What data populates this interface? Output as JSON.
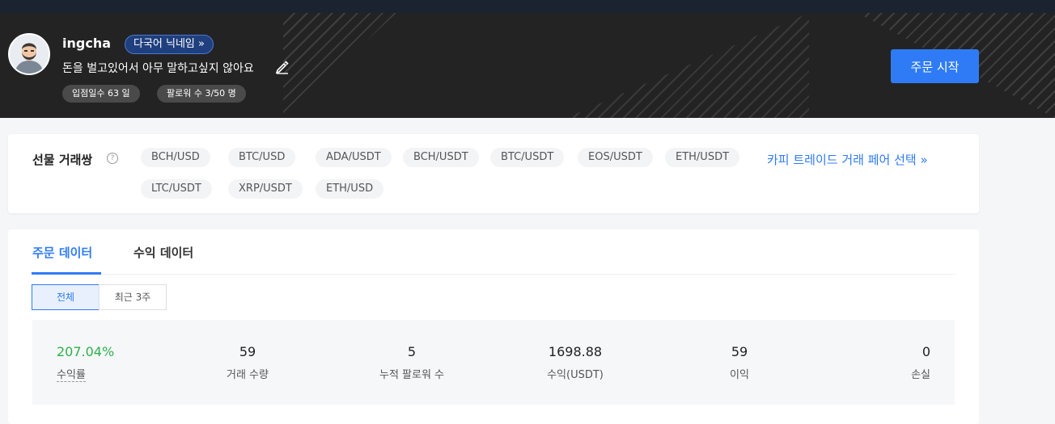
{
  "profile": {
    "username": "ingcha",
    "nickname_badge": "다국어 닉네임",
    "nickname_badge_icon": "double-chevron-right-icon",
    "motto": "돈을 벌고있어서 아무 말하고싶지 않아요",
    "edit_icon": "pencil-icon",
    "days_label": "입점일수 63 일",
    "followers_label": "팔로워 수 3/50 명",
    "start_button": "주문 시작"
  },
  "pairs": {
    "title": "선물 거래쌍",
    "help_icon": "question-circle-icon",
    "items": [
      "BCH/USD",
      "BTC/USD",
      "ADA/USDT",
      "BCH/USDT",
      "BTC/USDT",
      "EOS/USDT",
      "ETH/USDT",
      "LTC/USDT",
      "XRP/USDT",
      "ETH/USD"
    ],
    "copy_link": "카피 트레이드 거래 페어 선택"
  },
  "data": {
    "tabs": [
      "주문 데이터",
      "수익 데이터"
    ],
    "active_tab": "주문 데이터",
    "ranges": [
      "전체",
      "최근 3주"
    ],
    "active_range": "전체",
    "stats": [
      {
        "value": "207.04%",
        "label": "수익률"
      },
      {
        "value": "59",
        "label": "거래 수량"
      },
      {
        "value": "5",
        "label": "누적 팔로워 수"
      },
      {
        "value": "1698.88",
        "label": "수익(USDT)"
      },
      {
        "value": "59",
        "label": "이익"
      },
      {
        "value": "0",
        "label": "손실"
      }
    ]
  },
  "colors": {
    "accent": "#2f7bf5",
    "positive": "#2cb14a",
    "hero_bg": "#232323"
  }
}
